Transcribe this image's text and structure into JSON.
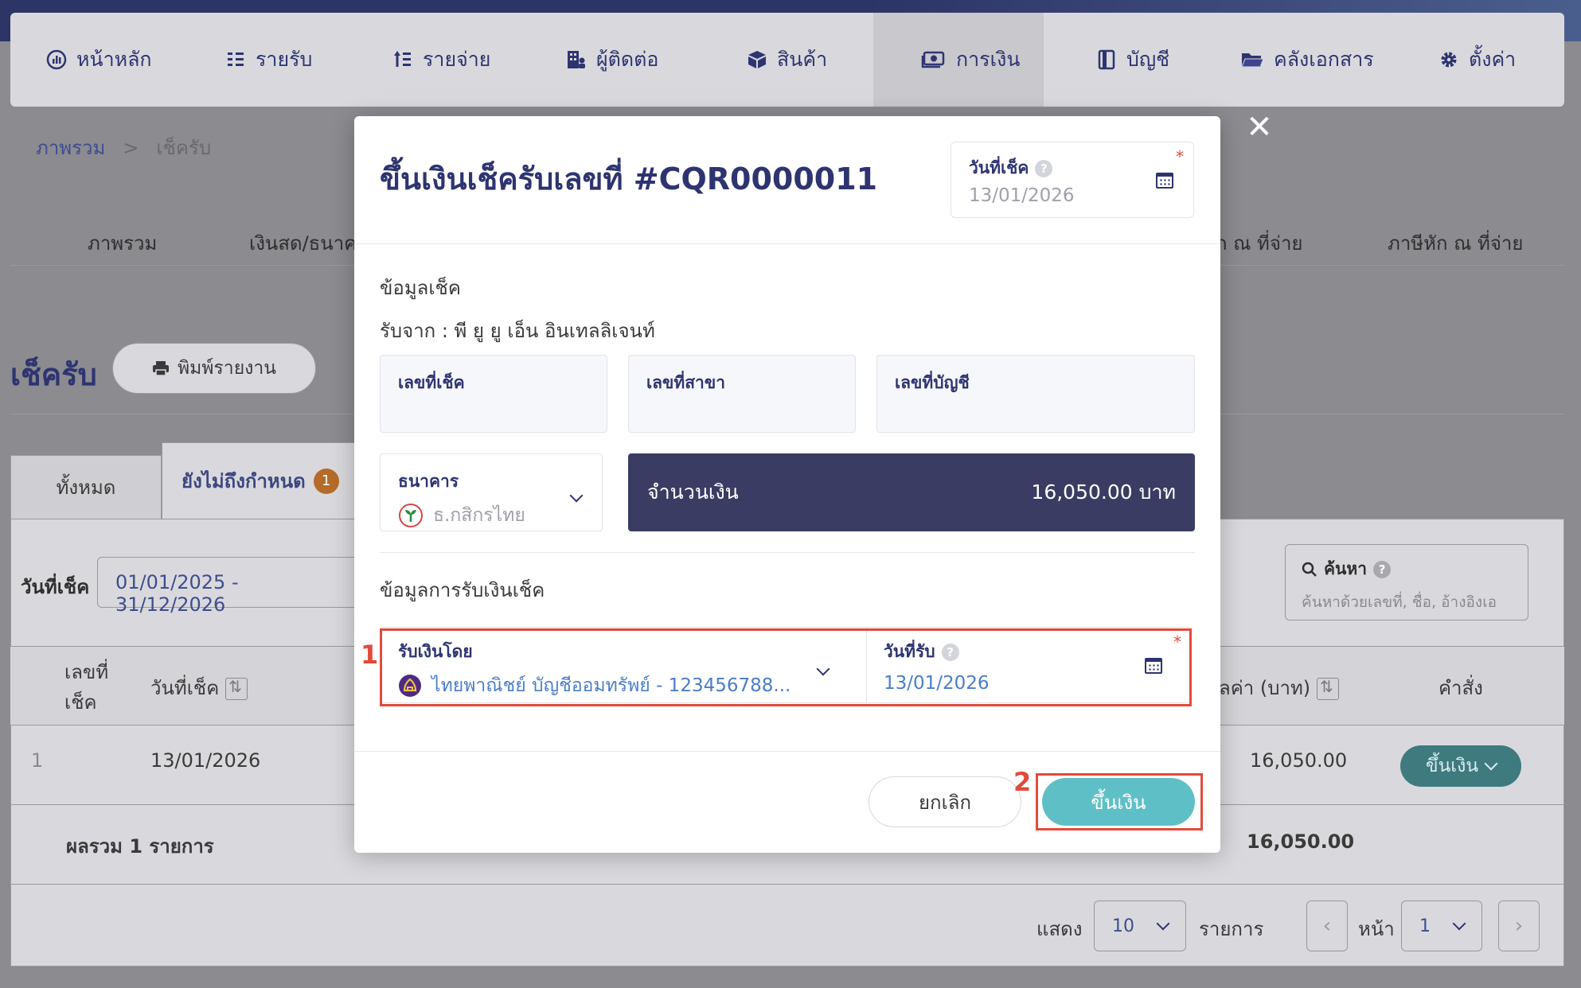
{
  "nav": {
    "items": [
      {
        "label": "หน้าหลัก",
        "icon": "dashboard-icon"
      },
      {
        "label": "รายรับ",
        "icon": "income-icon"
      },
      {
        "label": "รายจ่าย",
        "icon": "expense-icon"
      },
      {
        "label": "ผู้ติดต่อ",
        "icon": "contacts-icon"
      },
      {
        "label": "สินค้า",
        "icon": "box-icon"
      },
      {
        "label": "การเงิน",
        "icon": "money-icon"
      },
      {
        "label": "บัญชี",
        "icon": "ledger-icon"
      },
      {
        "label": "คลังเอกสาร",
        "icon": "folder-icon"
      },
      {
        "label": "ตั้งค่า",
        "icon": "gear-icon"
      }
    ],
    "active": "การเงิน"
  },
  "breadcrumb": {
    "root": "ภาพรวม",
    "sep": ">",
    "current": "เช็ครับ"
  },
  "subtabs": [
    "ภาพรวม",
    "เงินสด/ธนาคา",
    "ก ณ ที่จ่าย",
    "ภาษีหัก ณ ที่จ่าย"
  ],
  "page": {
    "title": "เช็ครับ",
    "print_label": "พิมพ์รายงาน"
  },
  "tabs": {
    "all": "ทั้งหมด",
    "pending": "ยังไม่ถึงกำหนด",
    "pending_count": "1"
  },
  "filter": {
    "date_label": "วันที่เช็ค",
    "date_range": "01/01/2025 - 31/12/2026"
  },
  "search": {
    "label": "ค้นหา",
    "placeholder": "ค้นหาด้วยเลขที่, ชื่อ, อ้างอิงเอ"
  },
  "table": {
    "headers": {
      "no": "เลขที่",
      "no2": "เช็ค",
      "date": "วันที่เช็ค",
      "value": "ลค่า (บาท)",
      "action": "คำสั่ง"
    },
    "rows": [
      {
        "no": "1",
        "date": "13/01/2026",
        "value": "16,050.00",
        "action": "ขึ้นเงิน"
      }
    ],
    "total_label": "ผลรวม 1 รายการ",
    "total_value": "16,050.00"
  },
  "pager": {
    "show": "แสดง",
    "per_page": "10",
    "items": "รายการ",
    "page_label": "หน้า",
    "page": "1"
  },
  "modal": {
    "title": "ขึ้นเงินเช็ครับเลขที่ #CQR0000011",
    "cheque_date_label": "วันที่เช็ค",
    "cheque_date": "13/01/2026",
    "section_info": "ข้อมูลเช็ค",
    "received_from": "รับจาก : พี ยู ยู เอ็น อินเทลลิเจนท์",
    "cheque_no_label": "เลขที่เช็ค",
    "branch_no_label": "เลขที่สาขา",
    "account_no_label": "เลขที่บัญชี",
    "bank_label": "ธนาคาร",
    "bank_value": "ธ.กสิกรไทย",
    "amount_label": "จำนวนเงิน",
    "amount_value": "16,050.00 บาท",
    "section_receive": "ข้อมูลการรับเงินเช็ค",
    "receive_by_label": "รับเงินโดย",
    "receive_by_value": "ไทยพาณิชย์ บัญชีออมทรัพย์ - 123456788...",
    "receive_date_label": "วันที่รับ",
    "receive_date": "13/01/2026",
    "cancel": "ยกเลิก",
    "confirm": "ขึ้นเงิน",
    "marker1": "1",
    "marker2": "2",
    "required_mark": "*"
  },
  "colors": {
    "primary": "#2e3470",
    "accent": "#5fbfc6",
    "highlight": "#e24a3b",
    "amount_bg": "#3b3c63"
  }
}
